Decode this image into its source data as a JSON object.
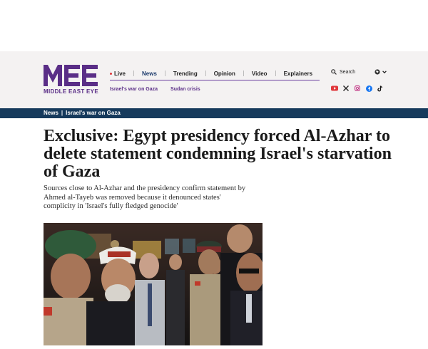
{
  "brand": {
    "logo_text": "MIDDLE EAST EYE",
    "color": "#5a2e87"
  },
  "nav": {
    "live": "Live",
    "items": [
      "News",
      "Trending",
      "Opinion",
      "Video",
      "Explainers"
    ],
    "active": "News",
    "search_label": "Search",
    "language_icon": "globe-icon"
  },
  "subnav": {
    "items": [
      "Israel's war on Gaza",
      "Sudan crisis"
    ]
  },
  "social": [
    "youtube-icon",
    "x-icon",
    "instagram-icon",
    "facebook-icon",
    "tiktok-icon"
  ],
  "breadcrumb": {
    "section": "News",
    "topic": "Israel's war on Gaza"
  },
  "article": {
    "headline": "Exclusive: Egypt presidency forced Al-Azhar to delete statement condemning Israel's starvation of Gaza",
    "standfirst": "Sources close to Al-Azhar and the presidency confirm statement by Ahmed al-Tayeb was removed because it denounced states' complicity in 'Israel's fully fledged genocide'"
  },
  "colors": {
    "header_bg": "#f4f2f2",
    "breadcrumb_bar": "#163a5c",
    "live_dot": "#e0373b"
  }
}
